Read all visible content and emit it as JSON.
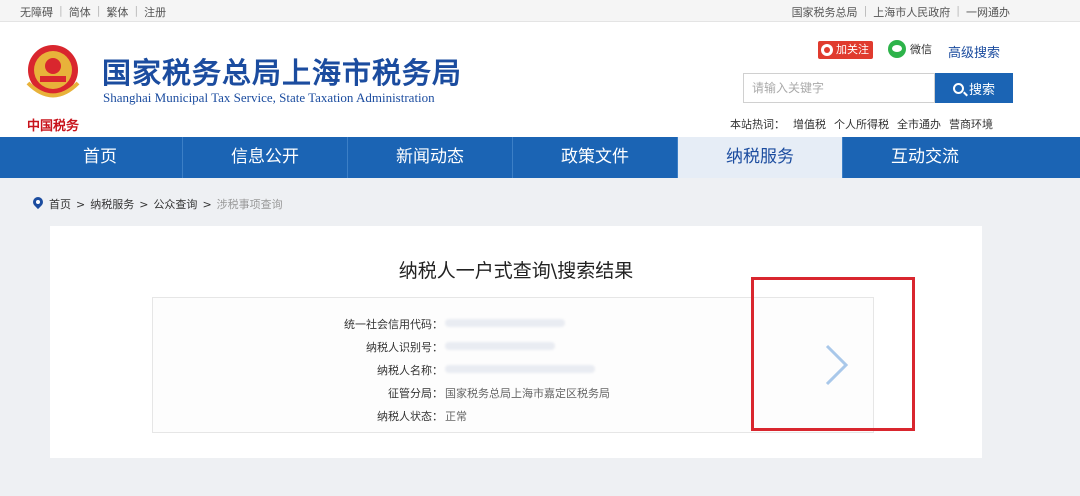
{
  "topbar": {
    "left": [
      "无障碍",
      "简体",
      "繁体",
      "注册"
    ],
    "right": [
      "国家税务总局",
      "上海市人民政府",
      "一网通办"
    ]
  },
  "header": {
    "emblem_caption": "中国税务",
    "title": "国家税务总局上海市税务局",
    "subtitle": "Shanghai Municipal Tax Service, State Taxation Administration",
    "follow_label": "加关注",
    "wechat_label": "微信",
    "advanced_search": "高级搜索",
    "search_placeholder": "请输入关键字",
    "search_button": "搜索",
    "hotwords_label": "本站热词：",
    "hotwords": [
      "增值税",
      "个人所得税",
      "全市通办",
      "营商环境"
    ]
  },
  "nav": {
    "items": [
      "首页",
      "信息公开",
      "新闻动态",
      "政策文件",
      "纳税服务",
      "互动交流"
    ],
    "active_index": 4
  },
  "breadcrumb": [
    "首页",
    "纳税服务",
    "公众查询",
    "涉税事项查询"
  ],
  "main": {
    "title": "纳税人一户式查询\\搜索结果",
    "fields": [
      {
        "label": "统一社会信用代码：",
        "value": ""
      },
      {
        "label": "纳税人识别号：",
        "value": ""
      },
      {
        "label": "纳税人名称：",
        "value": ""
      },
      {
        "label": "征管分局：",
        "value": "国家税务总局上海市嘉定区税务局"
      },
      {
        "label": "纳税人状态：",
        "value": "正常"
      }
    ]
  },
  "colors": {
    "brand_blue": "#1b4c9f",
    "nav_blue": "#1b64b4",
    "highlight_red": "#d9262e"
  }
}
